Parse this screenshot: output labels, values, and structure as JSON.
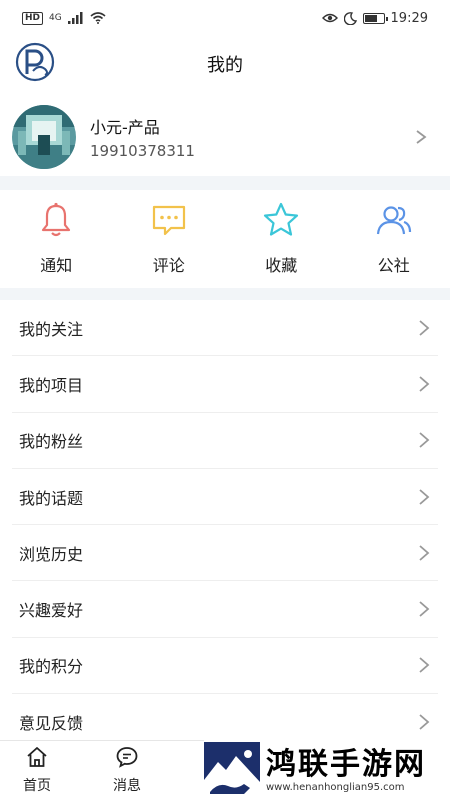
{
  "status_bar": {
    "left": [
      "HD",
      "4G"
    ],
    "time": "19:29"
  },
  "header": {
    "title": "我的"
  },
  "profile": {
    "name": "小元-产品",
    "phone": "19910378311"
  },
  "quick_actions": [
    {
      "label": "通知",
      "icon": "bell-icon",
      "color": "#e8736e"
    },
    {
      "label": "评论",
      "icon": "comment-icon",
      "color": "#f2c24b"
    },
    {
      "label": "收藏",
      "icon": "star-icon",
      "color": "#3bc6d8"
    },
    {
      "label": "公社",
      "icon": "community-icon",
      "color": "#5b93e6"
    }
  ],
  "menu": [
    {
      "label": "我的关注"
    },
    {
      "label": "我的项目"
    },
    {
      "label": "我的粉丝"
    },
    {
      "label": "我的话题"
    },
    {
      "label": "浏览历史"
    },
    {
      "label": "兴趣爱好"
    },
    {
      "label": "我的积分"
    },
    {
      "label": "意见反馈"
    }
  ],
  "tabbar": [
    {
      "label": "首页",
      "icon": "home-icon"
    },
    {
      "label": "消息",
      "icon": "message-icon"
    }
  ],
  "watermark": {
    "title": "鸿联手游网",
    "url": "www.henanhonglian95.com"
  }
}
